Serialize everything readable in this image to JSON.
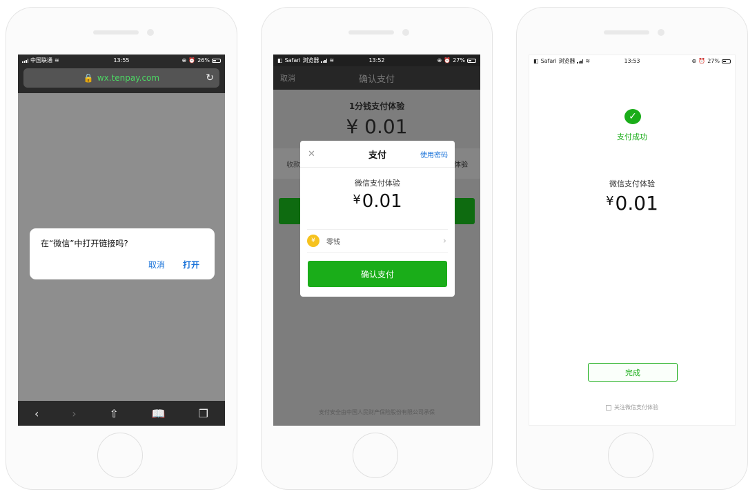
{
  "screen1": {
    "status": {
      "carrier": "中国联通",
      "time": "13:55",
      "battery": "26%"
    },
    "url": "wx.tenpay.com",
    "dialog": {
      "message": "在“微信”中打开链接吗?",
      "cancel": "取消",
      "open": "打开"
    }
  },
  "screen2": {
    "status": {
      "carrier": "Safari 浏览器",
      "time": "13:52",
      "battery": "27%"
    },
    "nav": {
      "title": "确认支付",
      "cancel": "取消"
    },
    "background": {
      "title": "1分钱支付体验",
      "amount": "¥ 0.01",
      "row_left": "收款",
      "row_right": "体验",
      "footer": "支付安全由中国人民财产保险股份有限公司承保"
    },
    "sheet": {
      "title": "支付",
      "use_password": "使用密码",
      "item": "微信支付体验",
      "currency": "¥",
      "amount": "0.01",
      "method": "零钱",
      "confirm": "确认支付"
    }
  },
  "screen3": {
    "status": {
      "carrier": "Safari 浏览器",
      "time": "13:53",
      "battery": "27%"
    },
    "success": "支付成功",
    "item": "微信支付体验",
    "currency": "¥",
    "amount": "0.01",
    "done": "完成",
    "follow": "关注微信支付体验"
  }
}
